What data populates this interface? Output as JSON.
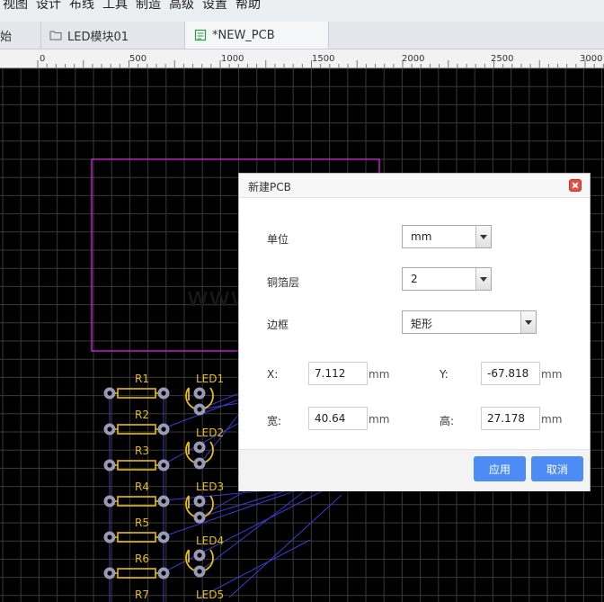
{
  "menu": [
    "视图",
    "设计",
    "布线",
    "工具",
    "制造",
    "高级",
    "设置",
    "帮助"
  ],
  "tabs": [
    {
      "label": "始",
      "icon": "none"
    },
    {
      "label": "LED模块01",
      "icon": "folder-icon"
    },
    {
      "label": "*NEW_PCB",
      "icon": "pcb-icon"
    }
  ],
  "ruler": {
    "ticks": [
      "0",
      "500",
      "1000",
      "1500",
      "2000",
      "2500",
      "3000"
    ]
  },
  "canvas": {
    "colors": {
      "grid": "#3a3a3a",
      "outline": "#c020c0",
      "silk": "#e8c000",
      "pad": "#9a9ab8",
      "track": "#3b3bd6"
    },
    "components": [
      {
        "type": "resistor",
        "label": "R1"
      },
      {
        "type": "led",
        "label": "LED1"
      },
      {
        "type": "resistor",
        "label": "R2"
      },
      {
        "type": "led",
        "label": "LED2"
      },
      {
        "type": "resistor",
        "label": "R3"
      },
      {
        "type": "led",
        "label": "LED3"
      },
      {
        "type": "resistor",
        "label": "R4"
      },
      {
        "type": "led",
        "label": "LED4"
      },
      {
        "type": "resistor",
        "label": "R5"
      },
      {
        "type": "resistor",
        "label": "R6"
      },
      {
        "type": "led",
        "label": "LED5"
      },
      {
        "type": "resistor",
        "label": "R7"
      }
    ]
  },
  "watermark": "www.mcublog.cn",
  "dialog": {
    "title": "新建PCB",
    "unit_label": "单位",
    "unit_value": "mm",
    "layers_label": "铜箔层",
    "layers_value": "2",
    "border_label": "边框",
    "border_value": "矩形",
    "x_label": "X:",
    "x_value": "7.112",
    "y_label": "Y:",
    "y_value": "-67.818",
    "w_label": "宽:",
    "w_value": "40.64",
    "h_label": "高:",
    "h_value": "27.178",
    "unit_suffix": "mm",
    "apply_label": "应用",
    "cancel_label": "取消"
  }
}
